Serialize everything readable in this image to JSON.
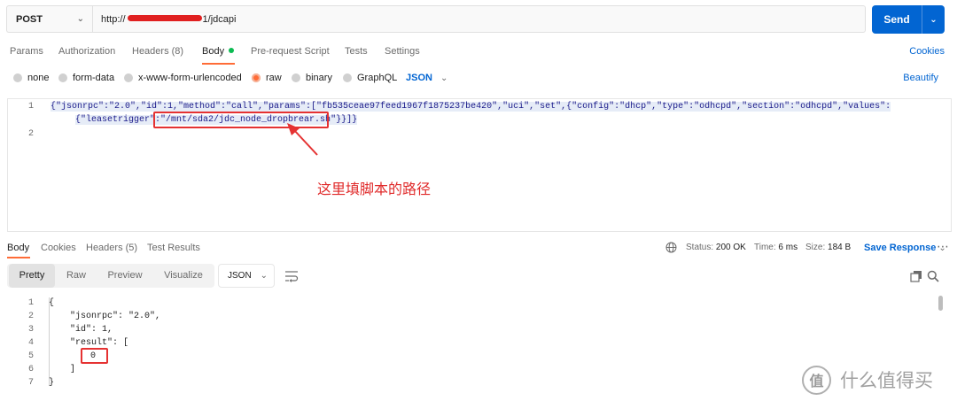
{
  "request": {
    "method": "POST",
    "url_prefix": "http://",
    "url_suffix": "1/jdcapi",
    "send_label": "Send"
  },
  "request_tabs": [
    {
      "label": "Params"
    },
    {
      "label": "Authorization"
    },
    {
      "label": "Headers (8)"
    },
    {
      "label": "Body"
    },
    {
      "label": "Pre-request Script"
    },
    {
      "label": "Tests"
    },
    {
      "label": "Settings"
    }
  ],
  "cookies_label": "Cookies",
  "body_types": [
    {
      "label": "none"
    },
    {
      "label": "form-data"
    },
    {
      "label": "x-www-form-urlencoded"
    },
    {
      "label": "raw"
    },
    {
      "label": "binary"
    },
    {
      "label": "GraphQL"
    }
  ],
  "body_format": "JSON",
  "beautify_label": "Beautify",
  "editor": {
    "line_numbers": [
      "1",
      "2"
    ],
    "line1": "{\"jsonrpc\":\"2.0\",\"id\":1,\"method\":\"call\",\"params\":[\"fb535ceae97feed1967f1875237be420\",\"uci\",\"set\",{\"config\":\"dhcp\",\"type\":\"odhcpd\",\"section\":\"odhcpd\",\"values\":",
    "line1b_pre": "{\"leasetrigger\":\"",
    "line1b_path": "/mnt/sda2/jdc_node_dropbrear.sh",
    "line1b_post": "\"}}]}",
    "annotation": "这里填脚本的路径"
  },
  "response_tabs": [
    {
      "label": "Body"
    },
    {
      "label": "Cookies"
    },
    {
      "label": "Headers (5)"
    },
    {
      "label": "Test Results"
    }
  ],
  "status": {
    "status_label": "Status:",
    "status_value": "200 OK",
    "time_label": "Time:",
    "time_value": "6 ms",
    "size_label": "Size:",
    "size_value": "184 B"
  },
  "save_response_label": "Save Response",
  "response_views": [
    {
      "label": "Pretty"
    },
    {
      "label": "Raw"
    },
    {
      "label": "Preview"
    },
    {
      "label": "Visualize"
    }
  ],
  "response_format": "JSON",
  "response_lines": {
    "numbers": [
      "1",
      "2",
      "3",
      "4",
      "5",
      "6",
      "7"
    ],
    "l1": "{",
    "l2": "\"jsonrpc\": \"2.0\",",
    "l3": "\"id\": 1,",
    "l4": "\"result\": [",
    "l5": "0",
    "l6": "]",
    "l7": "}"
  },
  "watermark": {
    "logo": "值",
    "text": "什么值得买"
  },
  "colors": {
    "accent": "#ff6c37",
    "link": "#0265d2",
    "send": "#0265d2",
    "annotation": "#e02a2a"
  }
}
